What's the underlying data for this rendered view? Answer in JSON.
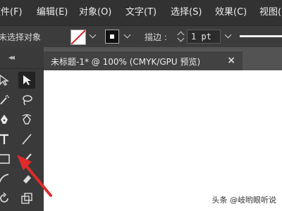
{
  "menu": {
    "items": [
      "文件(F)",
      "编辑(E)",
      "对象(O)",
      "文字(T)",
      "选择(S)",
      "效果(C)",
      "视图("
    ]
  },
  "control_bar": {
    "selection_status": "未选择对象",
    "stroke_label": "描边 :",
    "stroke_weight": "1 pt"
  },
  "document": {
    "tab_title": "未标题-1* @ 100% (CMYK/GPU 预览)",
    "close_glyph": "×"
  },
  "watermark": "头条 @岐哟眼听说",
  "colors": {
    "annotation_arrow": "#e02a2a",
    "menubar_bg": "#323232",
    "panel_bg": "#3a3a3a",
    "canvas_bg": "#ffffff"
  },
  "tools": [
    "direct-selection-icon",
    "selection-icon",
    "magic-wand-icon",
    "lasso-icon",
    "pen-icon",
    "curvature-icon",
    "type-icon",
    "line-segment-icon",
    "rectangle-icon",
    "paintbrush-icon",
    "shaper-icon",
    "eraser-icon",
    "rotate-icon",
    "scale-icon"
  ]
}
